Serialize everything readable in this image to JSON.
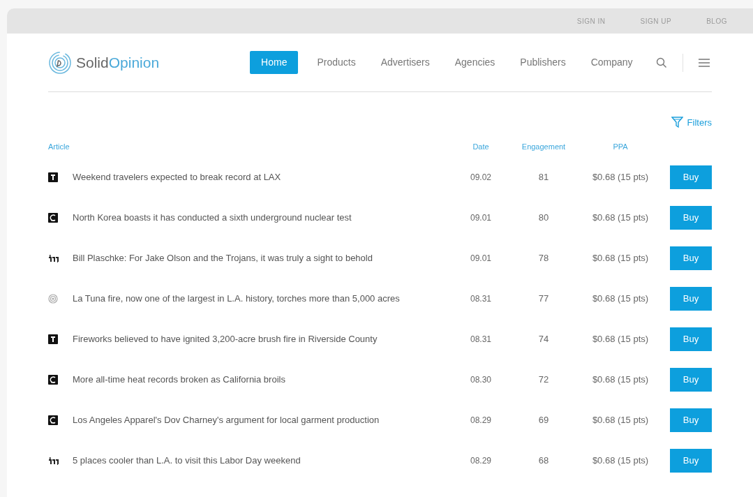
{
  "top_links": [
    "SIGN IN",
    "SIGN UP",
    "BLOG"
  ],
  "brand": {
    "part_1": "Solid",
    "part_2": "Opinion"
  },
  "nav": [
    {
      "label": "Home",
      "selected": true
    },
    {
      "label": "Products",
      "selected": false
    },
    {
      "label": "Advertisers",
      "selected": false
    },
    {
      "label": "Agencies",
      "selected": false
    },
    {
      "label": "Publishers",
      "selected": false
    },
    {
      "label": "Company",
      "selected": false
    }
  ],
  "filters": "Filters",
  "table": {
    "columns": [
      "Article",
      "Date",
      "Engagement",
      "PPA"
    ],
    "rows": [
      {
        "kind": "square-t",
        "article": "Weekend travelers expected to break record at LAX",
        "date": "09.02",
        "engagement": "81",
        "ppa": "$0.68 (15 pts)",
        "action": "Buy"
      },
      {
        "kind": "square-c",
        "article": "North Korea boasts it has conducted a sixth underground nuclear test",
        "date": "09.01",
        "engagement": "80",
        "ppa": "$0.68 (15 pts)",
        "action": "Buy"
      },
      {
        "kind": "blackletter",
        "article": "Bill Plaschke: For Jake Olson and the Trojans, it was truly a sight to behold",
        "date": "09.01",
        "engagement": "78",
        "ppa": "$0.68 (15 pts)",
        "action": "Buy"
      },
      {
        "kind": "rings",
        "article": "La Tuna fire, now one of the largest in L.A. history, torches more than 5,000 acres",
        "date": "08.31",
        "engagement": "77",
        "ppa": "$0.68 (15 pts)",
        "action": "Buy"
      },
      {
        "kind": "square-t",
        "article": "Fireworks believed to have ignited 3,200-acre brush fire in Riverside County",
        "date": "08.31",
        "engagement": "74",
        "ppa": "$0.68 (15 pts)",
        "action": "Buy"
      },
      {
        "kind": "square-c",
        "article": "More all-time heat records broken as California broils",
        "date": "08.30",
        "engagement": "72",
        "ppa": "$0.68 (15 pts)",
        "action": "Buy"
      },
      {
        "kind": "square-c",
        "article": "Los Angeles Apparel's Dov Charney's argument for local garment production",
        "date": "08.29",
        "engagement": "69",
        "ppa": "$0.68 (15 pts)",
        "action": "Buy"
      },
      {
        "kind": "blackletter",
        "article": "5 places cooler than L.A. to visit this Labor Day weekend",
        "date": "08.29",
        "engagement": "68",
        "ppa": "$0.68 (15 pts)",
        "action": "Buy"
      }
    ]
  }
}
